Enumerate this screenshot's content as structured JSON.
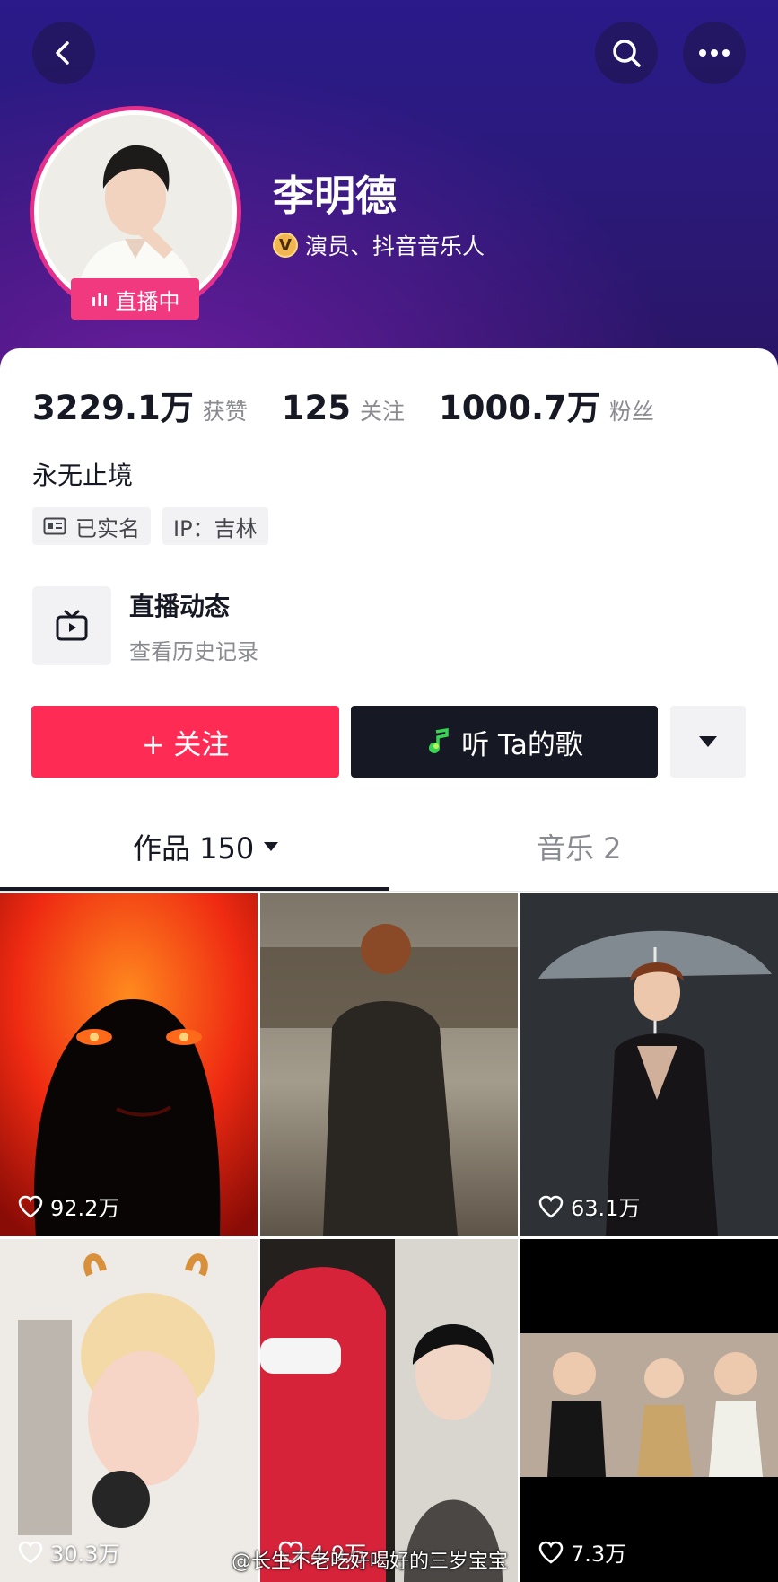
{
  "profile": {
    "name": "李明德",
    "verify_text": "演员、抖音音乐人",
    "verify_badge": "V",
    "live_badge": "直播中"
  },
  "stats": [
    {
      "value": "3229.1万",
      "label": "获赞"
    },
    {
      "value": "125",
      "label": "关注"
    },
    {
      "value": "1000.7万",
      "label": "粉丝"
    }
  ],
  "bio": "永无止境",
  "tags": {
    "realname": "已实名",
    "ip": "IP：吉林"
  },
  "live_card": {
    "title": "直播动态",
    "subtitle": "查看历史记录"
  },
  "actions": {
    "follow": "+ 关注",
    "listen": "听 Ta的歌"
  },
  "tabs": {
    "works": "作品 150",
    "music": "音乐 2"
  },
  "videos": [
    {
      "likes": "92.2万"
    },
    {
      "likes": ""
    },
    {
      "likes": "63.1万"
    },
    {
      "likes": "30.3万"
    },
    {
      "likes": "4.9万"
    },
    {
      "likes": "7.3万"
    }
  ],
  "watermark": "@长生不老吃好喝好的三岁宝宝",
  "colors": {
    "follow": "#fe2c55",
    "dark": "#161823",
    "live": "#f0397f",
    "header": "#2a1a8a"
  },
  "icons": [
    "back-icon",
    "search-icon",
    "more-icon",
    "live-bars-icon",
    "tv-icon",
    "music-note-icon",
    "caret-down-icon",
    "heart-icon",
    "id-card-icon"
  ]
}
